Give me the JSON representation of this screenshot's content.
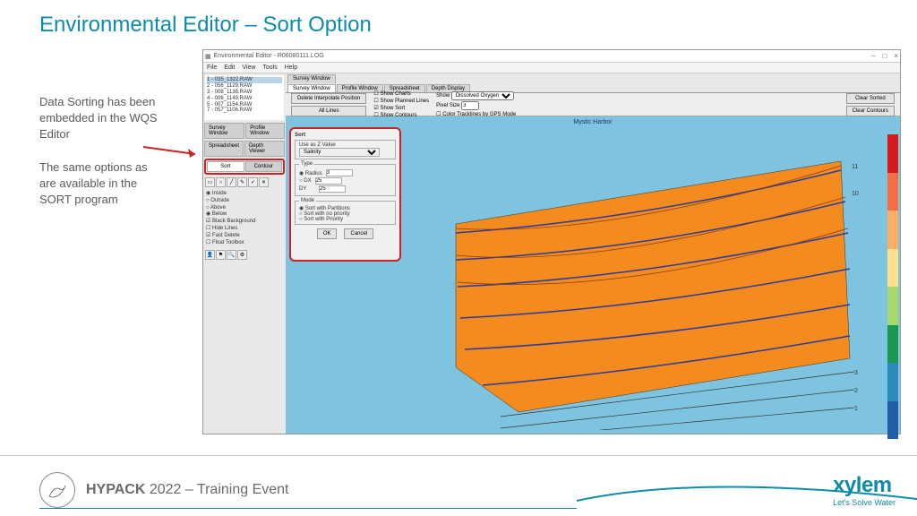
{
  "slide": {
    "title": "Environmental Editor – Sort Option"
  },
  "annotations": {
    "a1": "Data Sorting has been embedded in the WQS Editor",
    "a2": "The same options as are available in the SORT program"
  },
  "app": {
    "title": "Environmental Editor - R06080111.LOG",
    "menu": [
      "File",
      "Edit",
      "View",
      "Tools",
      "Help"
    ],
    "files": [
      "1 - 035_1322.RAW",
      "2 - 056_1129.RAW",
      "3 - 008_1138.RAW",
      "4 - 006_1149.RAW",
      "5 - 007_1154.RAW",
      "7 - 057_1106.RAW"
    ],
    "leftTabs1": [
      "Survey Window",
      "Profile Window"
    ],
    "leftTabs2": [
      "Spreadsheet",
      "Depth Viewer"
    ],
    "sortTab": "Sort",
    "contourTab": "Contour",
    "radios": {
      "inside": "Inside",
      "outside": "Outside",
      "above": "Above",
      "below": "Below",
      "blackbg": "Black Background",
      "hidelines": "Hide Lines",
      "fastdel": "Fast Delete",
      "floattb": "Float Toolbox"
    },
    "upperBlockLabel": "Survey Window",
    "upperTabs": [
      "Survey Window",
      "Profile Window",
      "Spreadsheet",
      "Depth Display"
    ],
    "controls": {
      "deleteBtn": "Delete Interpolate Position",
      "allLines": "All Lines",
      "showCharts": "Show Charts",
      "showPlanned": "Show Planned Lines",
      "showSort": "Show Sort",
      "showContours": "Show Contours",
      "showLbl": "Show",
      "showSel": "Dissolved Oxygen",
      "pixelLbl": "Pixel Size",
      "pixelVal": "3",
      "colorTrack": "Color Tracklines by GPS Mode",
      "clearSorted": "Clear Sorted",
      "clearContours": "Clear Contours"
    },
    "mapTitle": "Mystic Harbor",
    "dialog": {
      "title": "Sort",
      "useZ": "Use as Z Value",
      "zSel": "Salinity",
      "typeLbl": "Type",
      "radiusLbl": "Radius",
      "radiusVal": "3",
      "dxLbl": "DX",
      "dxVal": "25",
      "dyLbl": "DY",
      "dyVal": "25",
      "modeLbl": "Mode",
      "m1": "Sort with Partitions",
      "m2": "Sort with no priority",
      "m3": "Sort with Priority",
      "ok": "OK",
      "cancel": "Cancel"
    }
  },
  "footer": {
    "brand": "HYPACK",
    "year": "2022",
    "event": " – Training Event",
    "xylem": "xylem",
    "tagline": "Let's Solve Water"
  },
  "scale_colors": [
    "#d7191c",
    "#f46d43",
    "#fdae61",
    "#fee08b",
    "#a6d96a",
    "#1a9850",
    "#2b8cbe",
    "#225ea8"
  ]
}
